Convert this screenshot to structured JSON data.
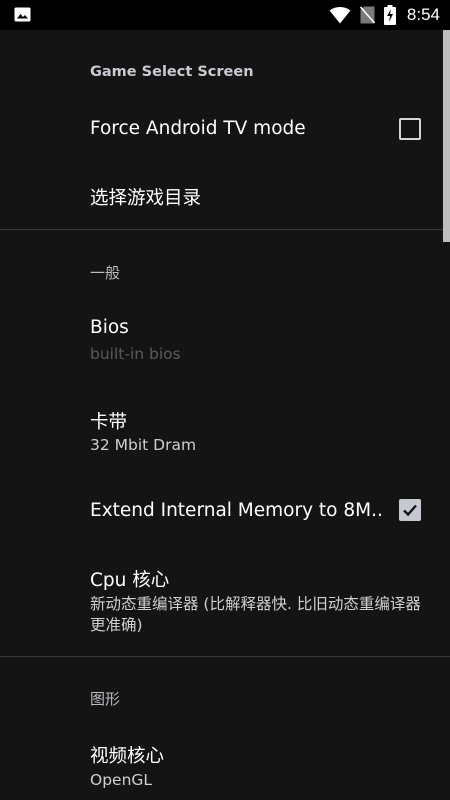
{
  "status_bar": {
    "time": "8:54",
    "icons": [
      "image-icon",
      "wifi-icon",
      "no-sim-icon",
      "battery-charging-icon"
    ]
  },
  "sections": [
    {
      "header": "Game Select Screen",
      "items": [
        {
          "title": "Force Android TV mode",
          "checkbox": false
        },
        {
          "title": "选择游戏目录"
        }
      ]
    },
    {
      "header": "一般",
      "items": [
        {
          "title": "Bios",
          "summary": "built-in bios",
          "disabled": true
        },
        {
          "title": "卡带",
          "summary": "32 Mbit Dram"
        },
        {
          "title": "Extend Internal Memory to 8M..",
          "checkbox": true
        },
        {
          "title": "Cpu 核心",
          "summary": "新动态重编译器 (比解释器快. 比旧动态重编译器更准确)"
        }
      ]
    },
    {
      "header": "图形",
      "items": [
        {
          "title": "视频核心",
          "summary": "OpenGL"
        }
      ]
    }
  ],
  "colors": {
    "background": "#141414",
    "status_bar": "#000000",
    "divider": "#383838",
    "disabled_text": "#5a5a5a"
  }
}
